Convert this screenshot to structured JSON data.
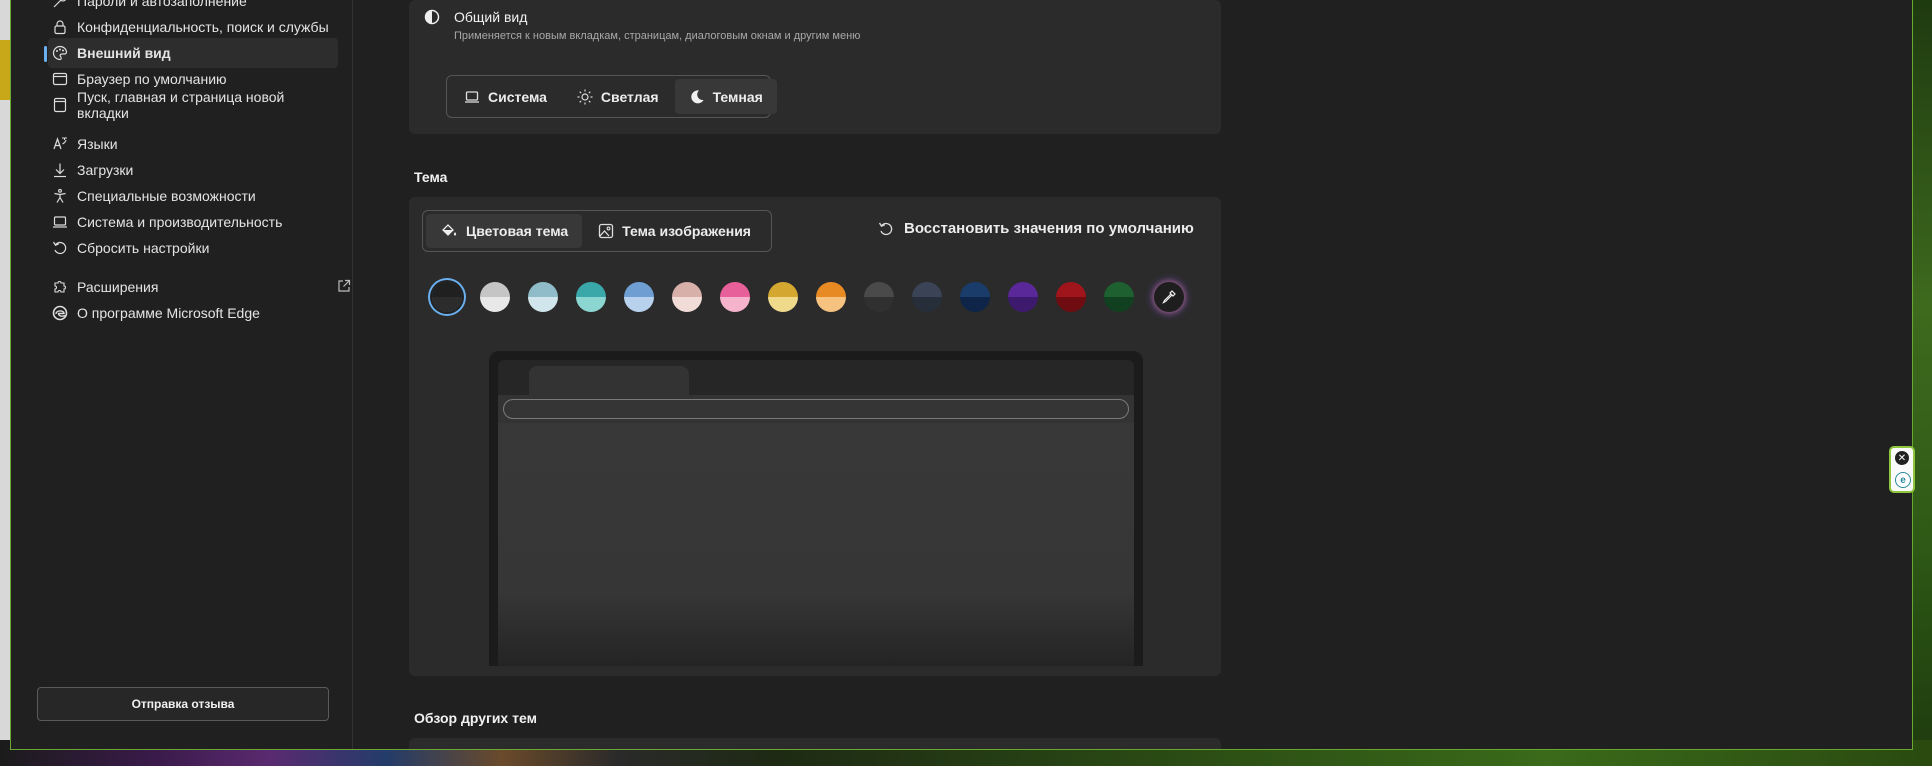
{
  "sidebar": {
    "items": [
      {
        "label": "Пароли и автозаполнение",
        "icon": "key-icon"
      },
      {
        "label": "Конфиденциальность, поиск и службы",
        "icon": "lock-icon"
      },
      {
        "label": "Внешний вид",
        "icon": "palette-icon",
        "active": true
      },
      {
        "label": "Браузер по умолчанию",
        "icon": "browser-icon"
      },
      {
        "label": "Пуск, главная и страница новой вкладки",
        "icon": "home-page-icon"
      },
      {
        "label": "Языки",
        "icon": "language-icon"
      },
      {
        "label": "Загрузки",
        "icon": "download-icon"
      },
      {
        "label": "Специальные возможности",
        "icon": "accessibility-icon"
      },
      {
        "label": "Система и производительность",
        "icon": "laptop-icon"
      },
      {
        "label": "Сбросить настройки",
        "icon": "reset-icon"
      },
      {
        "label": "Расширения",
        "icon": "puzzle-icon"
      },
      {
        "label": "О программе Microsoft Edge",
        "icon": "edge-logo-icon"
      }
    ],
    "feedback_label": "Отправка отзыва"
  },
  "overall": {
    "title": "Общий вид",
    "description": "Применяется к новым вкладкам, страницам, диалоговым окнам и другим меню",
    "options": [
      "Система",
      "Светлая",
      "Темная"
    ],
    "selected": "Темная"
  },
  "theme": {
    "section_title": "Тема",
    "tabs": [
      "Цветовая тема",
      "Тема изображения"
    ],
    "selected_tab": "Цветовая тема",
    "reset_label": "Восстановить значения по умолчанию",
    "swatches": [
      {
        "top": "#202020",
        "bottom": "#2c2c2c",
        "selected": true
      },
      {
        "top": "#c5c5c5",
        "bottom": "#e8e8e8"
      },
      {
        "top": "#8fbcc8",
        "bottom": "#d0e6ec"
      },
      {
        "top": "#3aa8a8",
        "bottom": "#8cd6d2"
      },
      {
        "top": "#6e9ed2",
        "bottom": "#b8d2ee"
      },
      {
        "top": "#d8b0aa",
        "bottom": "#f1dcd8"
      },
      {
        "top": "#e8609a",
        "bottom": "#f6b4cc"
      },
      {
        "top": "#d4a830",
        "bottom": "#efd98a"
      },
      {
        "top": "#e88a24",
        "bottom": "#f6c280"
      },
      {
        "top": "#4a4a4a",
        "bottom": "#303030"
      },
      {
        "top": "#3a4456",
        "bottom": "#262e3a"
      },
      {
        "top": "#1a3c6a",
        "bottom": "#0e2448"
      },
      {
        "top": "#5a2898",
        "bottom": "#3e1a6e"
      },
      {
        "top": "#a0141c",
        "bottom": "#6e0c12"
      },
      {
        "top": "#1e6030",
        "bottom": "#104020"
      }
    ]
  },
  "other_themes_title": "Обзор других тем"
}
